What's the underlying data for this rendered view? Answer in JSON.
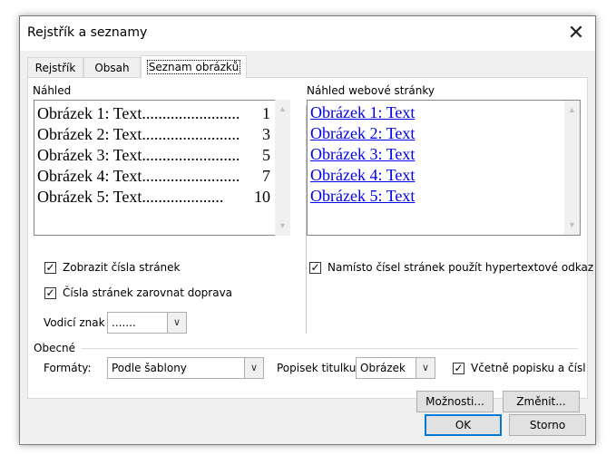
{
  "window": {
    "title": "Rejstřík a seznamy",
    "close_icon": "close-icon"
  },
  "tabs": [
    {
      "label": "Rejstřík",
      "active": false
    },
    {
      "label": "Obsah",
      "active": false
    },
    {
      "label": "Seznam obrázků",
      "active": true
    }
  ],
  "print_preview": {
    "label": "Náhled",
    "items": [
      {
        "text": "Obrázek 1: Text",
        "page": "1"
      },
      {
        "text": "Obrázek 2: Text",
        "page": "3"
      },
      {
        "text": "Obrázek 3: Text",
        "page": "5"
      },
      {
        "text": "Obrázek 4: Text",
        "page": "7"
      },
      {
        "text": "Obrázek 5: Text",
        "page": "10"
      }
    ]
  },
  "web_preview": {
    "label": "Náhled webové stránky",
    "items": [
      "Obrázek 1: Text",
      "Obrázek 2: Text",
      "Obrázek 3: Text",
      "Obrázek 4: Text",
      "Obrázek 5: Text"
    ]
  },
  "options": {
    "show_page_numbers": {
      "label": "Zobrazit čísla stránek",
      "checked": true
    },
    "right_align": {
      "label": "Čísla stránek zarovnat doprava",
      "checked": true
    },
    "tab_leader": {
      "label": "Vodicí znak",
      "value": "......."
    },
    "use_hyperlinks": {
      "label": "Namísto čísel stránek použít hypertextové odkaz",
      "checked": true
    }
  },
  "general": {
    "label": "Obecné",
    "formats": {
      "label": "Formáty:",
      "value": "Podle šablony"
    },
    "caption": {
      "label": "Popisek titulku",
      "value": "Obrázek"
    },
    "include_label": {
      "label": "Včetně popisku a čísl",
      "checked": true
    }
  },
  "buttons": {
    "options": "Možnosti...",
    "modify": "Změnit...",
    "ok": "OK",
    "cancel": "Storno"
  }
}
